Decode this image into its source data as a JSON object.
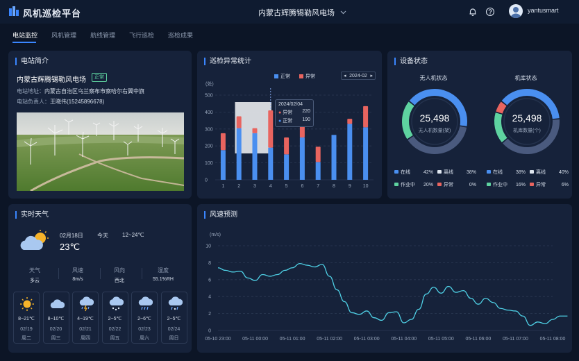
{
  "app": {
    "title": "风机巡检平台",
    "station": "内蒙古辉腾锡勒风电场",
    "username": "yantusmart"
  },
  "nav": {
    "tabs": [
      "电站监控",
      "风机管理",
      "航线管理",
      "飞行巡检",
      "巡检成果"
    ],
    "active": 0
  },
  "intro": {
    "title": "电站简介",
    "name": "内蒙古辉腾锡勒风电场",
    "status": "正常",
    "address_label": "电站地址：",
    "address": "内蒙古自治区乌兰察布市察哈尔右翼中旗",
    "contact_label": "电站负责人：",
    "contact": "王晓伟(15245896678)"
  },
  "anomaly": {
    "title": "巡检异常统计",
    "legend_normal": "正常",
    "legend_abnormal": "异常",
    "month": "2024-02",
    "unit": "(处)",
    "tooltip": {
      "date": "2024/02/04",
      "abnormal_label": "异常",
      "abnormal_value": "220",
      "normal_label": "正常",
      "normal_value": "190"
    }
  },
  "chart_data": [
    {
      "type": "bar",
      "stacked": true,
      "title": "巡检异常统计",
      "ylabel": "(处)",
      "categories": [
        "1",
        "2",
        "3",
        "4",
        "5",
        "6",
        "7",
        "8",
        "9",
        "10"
      ],
      "ylim": [
        0,
        500
      ],
      "yticks": [
        0,
        100,
        200,
        300,
        400,
        500
      ],
      "series": [
        {
          "name": "正常",
          "color": "#4a8ff0",
          "values": [
            175,
            305,
            275,
            190,
            150,
            250,
            105,
            265,
            330,
            310
          ]
        },
        {
          "name": "异常",
          "color": "#e8645f",
          "values": [
            100,
            70,
            30,
            220,
            100,
            75,
            90,
            0,
            30,
            125
          ]
        }
      ],
      "grid": true,
      "legend": "top-center"
    },
    {
      "type": "line",
      "title": "风速预测",
      "ylabel": "(m/s)",
      "ylim": [
        0,
        10
      ],
      "yticks": [
        0,
        2,
        4,
        6,
        8,
        10
      ],
      "xticks": [
        "05-10 23:00",
        "05-11 00:00",
        "05-11 01:00",
        "05-11 02:00",
        "05-11 03:00",
        "05-11 04:00",
        "05-11 05:00",
        "05-11 06:00",
        "05-11 07:00",
        "05-11 08:00"
      ],
      "x": [
        0,
        0.2,
        0.4,
        0.6,
        0.8,
        1.0,
        1.2,
        1.4,
        1.6,
        1.8,
        2.0,
        2.2,
        2.4,
        2.6,
        2.8,
        3.0,
        3.2,
        3.4,
        3.6,
        3.8,
        4.0,
        4.2,
        4.4,
        4.6,
        4.8,
        5.0,
        5.2,
        5.4,
        5.6,
        5.8,
        6.0,
        6.2,
        6.4,
        6.6,
        6.8,
        7.0,
        7.2,
        7.4,
        7.6,
        7.8,
        8.0,
        8.2,
        8.4,
        8.6,
        8.8,
        9.0,
        9.2,
        9.4
      ],
      "values": [
        7.4,
        7.1,
        6.9,
        7.0,
        6.2,
        5.9,
        6.6,
        6.4,
        6.6,
        7.1,
        7.4,
        7.9,
        7.7,
        7.5,
        7.8,
        6.4,
        4.8,
        3.4,
        2.1,
        1.9,
        2.3,
        1.5,
        1.2,
        2.1,
        2.2,
        0.9,
        1.3,
        2.5,
        4.3,
        5.1,
        4.4,
        5.2,
        4.5,
        4.7,
        3.8,
        3.1,
        3.8,
        3.3,
        2.6,
        2.4,
        2.3,
        1.7,
        0.6,
        1.0,
        0.8,
        1.3,
        1.7,
        1.7
      ],
      "color": "#4fd1e6",
      "grid": true
    },
    {
      "type": "pie",
      "title": "无人机状态",
      "center_value": "25,498",
      "center_label": "无人机数量(架)",
      "series": [
        {
          "name": "在线",
          "value": 42,
          "color": "#4a8ff0"
        },
        {
          "name": "离线",
          "value": 38,
          "color": "#dfe6ef"
        },
        {
          "name": "作业中",
          "value": 20,
          "color": "#5ed3a0"
        },
        {
          "name": "异常",
          "value": 0,
          "color": "#e8645f"
        }
      ]
    },
    {
      "type": "pie",
      "title": "机库状态",
      "center_value": "25,498",
      "center_label": "机库数量(个)",
      "series": [
        {
          "name": "在线",
          "value": 38,
          "color": "#4a8ff0"
        },
        {
          "name": "离线",
          "value": 40,
          "color": "#dfe6ef"
        },
        {
          "name": "作业中",
          "value": 16,
          "color": "#5ed3a0"
        },
        {
          "name": "异常",
          "value": 6,
          "color": "#e8645f"
        }
      ]
    }
  ],
  "device": {
    "title": "设备状态",
    "drone": {
      "title": "无人机状态",
      "count": "25,498",
      "count_label": "无人机数量(架)",
      "legend": [
        {
          "label": "在线",
          "pct": "42%"
        },
        {
          "label": "离线",
          "pct": "38%"
        },
        {
          "label": "作业中",
          "pct": "20%"
        },
        {
          "label": "异常",
          "pct": "0%"
        }
      ]
    },
    "hangar": {
      "title": "机库状态",
      "count": "25,498",
      "count_label": "机库数量(个)",
      "legend": [
        {
          "label": "在线",
          "pct": "38%"
        },
        {
          "label": "离线",
          "pct": "40%"
        },
        {
          "label": "作业中",
          "pct": "16%"
        },
        {
          "label": "异常",
          "pct": "6%"
        }
      ]
    }
  },
  "weather": {
    "title": "实时天气",
    "date": "02月18日",
    "day": "今天",
    "range": "12~24℃",
    "temp": "23℃",
    "stats": [
      {
        "label": "天气",
        "value": "多云"
      },
      {
        "label": "风速",
        "value": "8m/s"
      },
      {
        "label": "风向",
        "value": "西北"
      },
      {
        "label": "湿度",
        "value": "55.1%RH"
      }
    ],
    "forecast": [
      {
        "icon": "sun-icon",
        "temp": "8~21℃",
        "date": "02/19",
        "day": "周二"
      },
      {
        "icon": "cloud-icon",
        "temp": "8~10℃",
        "date": "02/20",
        "day": "周三"
      },
      {
        "icon": "thunder-rain-icon",
        "temp": "4~19℃",
        "date": "02/21",
        "day": "周四"
      },
      {
        "icon": "snow-icon",
        "temp": "2~5℃",
        "date": "02/22",
        "day": "周五"
      },
      {
        "icon": "rain-icon",
        "temp": "2~6℃",
        "date": "02/23",
        "day": "周六"
      },
      {
        "icon": "snow-rain-icon",
        "temp": "2~5℃",
        "date": "02/24",
        "day": "周日"
      }
    ]
  },
  "wind": {
    "title": "风速预测",
    "unit": "(m/s)"
  }
}
